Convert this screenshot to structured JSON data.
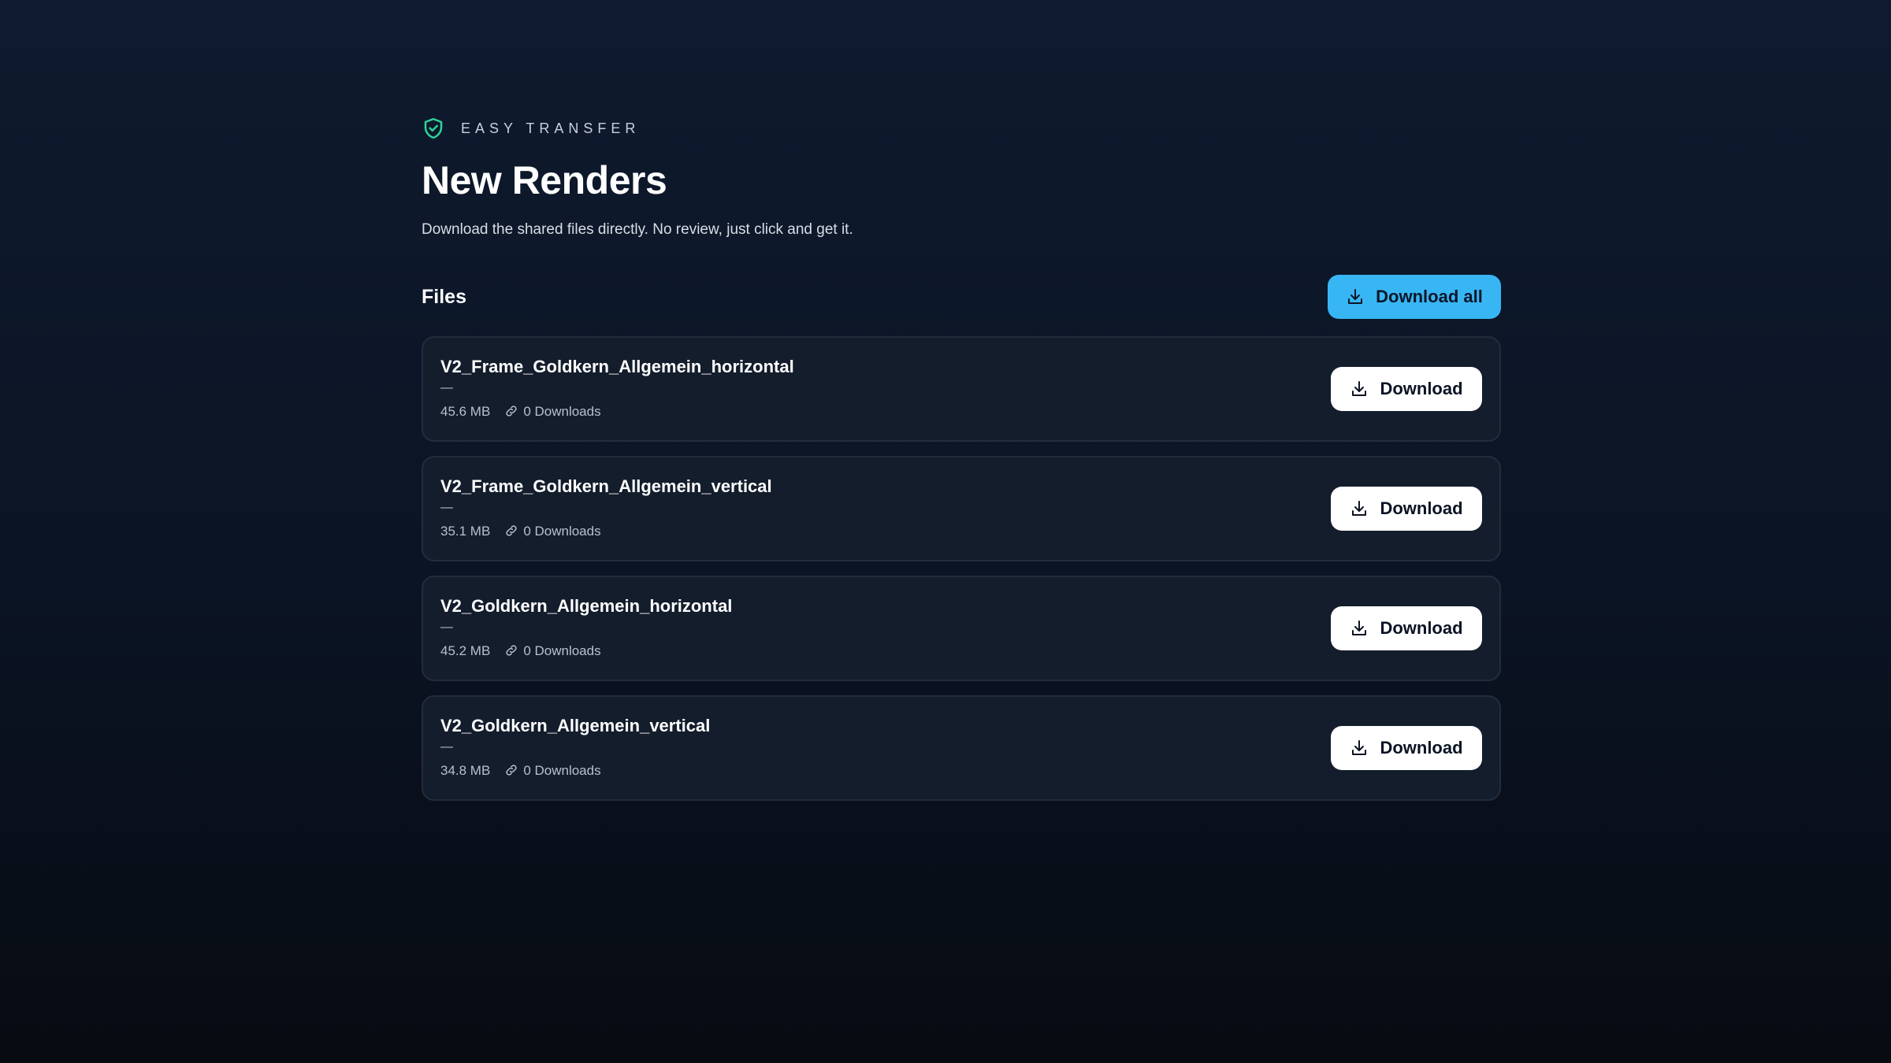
{
  "brand": {
    "label": "EASY TRANSFER",
    "icon": "shield-check-icon",
    "accent_color": "#2fd39a"
  },
  "page": {
    "title": "New Renders",
    "subtitle": "Download the shared files directly. No review, just click and get it."
  },
  "files_section": {
    "title": "Files",
    "download_all_label": "Download all",
    "download_all_color": "#38b6f4"
  },
  "files": [
    {
      "name": "V2_Frame_Goldkern_Allgemein_horizontal",
      "description": "—",
      "size": "45.6 MB",
      "downloads": "0 Downloads",
      "button_label": "Download"
    },
    {
      "name": "V2_Frame_Goldkern_Allgemein_vertical",
      "description": "—",
      "size": "35.1 MB",
      "downloads": "0 Downloads",
      "button_label": "Download"
    },
    {
      "name": "V2_Goldkern_Allgemein_horizontal",
      "description": "—",
      "size": "45.2 MB",
      "downloads": "0 Downloads",
      "button_label": "Download"
    },
    {
      "name": "V2_Goldkern_Allgemein_vertical",
      "description": "—",
      "size": "34.8 MB",
      "downloads": "0 Downloads",
      "button_label": "Download"
    }
  ]
}
